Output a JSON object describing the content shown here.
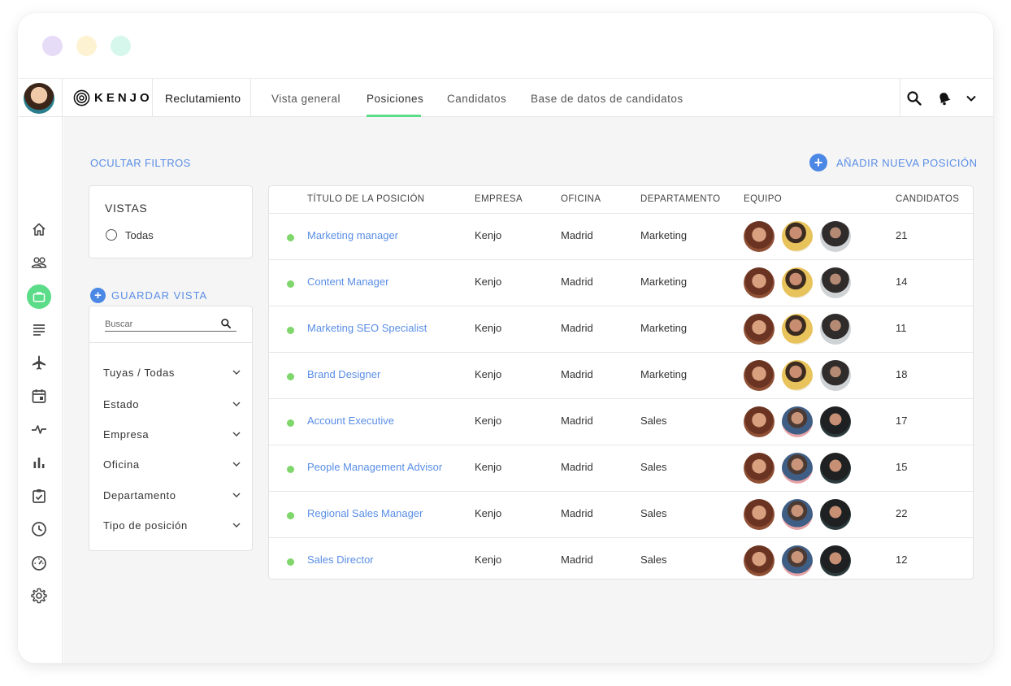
{
  "window": {
    "dot_colors": [
      "#e7dcf8",
      "#fdf3d3",
      "#d6f8ec"
    ]
  },
  "topbar": {
    "logo_text": "KENJO",
    "module_title": "Reclutamiento",
    "tabs": [
      {
        "label": "Vista general",
        "active": false
      },
      {
        "label": "Posiciones",
        "active": true
      },
      {
        "label": "Candidatos",
        "active": false
      },
      {
        "label": "Base de datos de candidatos",
        "active": false
      }
    ],
    "icons": [
      "search-icon",
      "bell-icon",
      "chevron-down-icon"
    ]
  },
  "sidebar": {
    "items": [
      "home-icon",
      "people-icon",
      "briefcase-icon",
      "list-icon",
      "plane-icon",
      "calendar-icon",
      "pulse-icon",
      "bar-chart-icon",
      "checklist-icon",
      "clock-icon",
      "speedometer-icon",
      "gear-icon"
    ],
    "active_item": "briefcase-icon",
    "accent_color": "#5bdc88"
  },
  "filters": {
    "hide_label": "OCULTAR FILTROS",
    "views_title": "VISTAS",
    "views_option": "Todas",
    "save_view_label": "GUARDAR VISTA",
    "search_placeholder": "Buscar",
    "items": [
      "Tuyas / Todas",
      "Estado",
      "Empresa",
      "Oficina",
      "Departamento",
      "Tipo de posición"
    ]
  },
  "actions": {
    "add_position_label": "AÑADIR NUEVA POSICIÓN"
  },
  "table": {
    "headers": {
      "title": "TÍTULO DE LA POSICIÓN",
      "company": "EMPRESA",
      "office": "OFICINA",
      "department": "DEPARTAMENTO",
      "team": "EQUIPO",
      "candidates": "CANDIDATOS"
    },
    "rows": [
      {
        "title": "Marketing manager",
        "company": "Kenjo",
        "office": "Madrid",
        "department": "Marketing",
        "candidates": "21"
      },
      {
        "title": "Content Manager",
        "company": "Kenjo",
        "office": "Madrid",
        "department": "Marketing",
        "candidates": "14"
      },
      {
        "title": "Marketing SEO Specialist",
        "company": "Kenjo",
        "office": "Madrid",
        "department": "Marketing",
        "candidates": "11"
      },
      {
        "title": "Brand Designer",
        "company": "Kenjo",
        "office": "Madrid",
        "department": "Marketing",
        "candidates": "18"
      },
      {
        "title": "Account Executive",
        "company": "Kenjo",
        "office": "Madrid",
        "department": "Sales",
        "candidates": "17"
      },
      {
        "title": "People Management Advisor",
        "company": "Kenjo",
        "office": "Madrid",
        "department": "Sales",
        "candidates": "15"
      },
      {
        "title": "Regional Sales Manager",
        "company": "Kenjo",
        "office": "Madrid",
        "department": "Sales",
        "candidates": "22"
      },
      {
        "title": "Sales Director",
        "company": "Kenjo",
        "office": "Madrid",
        "department": "Sales",
        "candidates": "12"
      }
    ],
    "status_color": "#7fd66b"
  }
}
